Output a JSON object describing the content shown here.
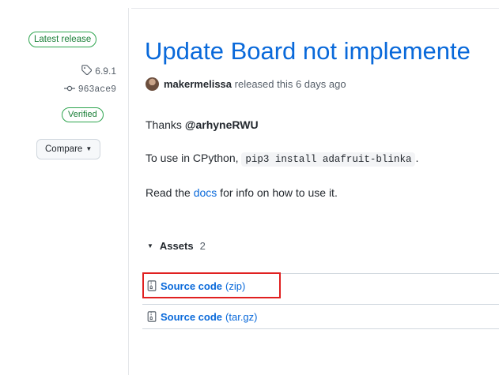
{
  "sidebar": {
    "latest_badge": "Latest release",
    "tag": "6.9.1",
    "commit": "963ace9",
    "verified": "Verified",
    "compare_label": "Compare"
  },
  "release": {
    "title": "Update Board not implemente",
    "author": "makermelissa",
    "released_text": "released this 6 days ago",
    "thanks_prefix": "Thanks ",
    "thanks_user": "@arhyneRWU",
    "cpython_prefix": "To use in CPython,",
    "cpython_command": "pip3 install adafruit-blinka",
    "cpython_suffix": ".",
    "read_prefix": "Read the ",
    "docs_link": "docs",
    "read_suffix": " for info on how to use it."
  },
  "assets": {
    "label": "Assets",
    "count": "2",
    "items": [
      {
        "name": "Source code",
        "format": "(zip)"
      },
      {
        "name": "Source code",
        "format": "(tar.gz)"
      }
    ]
  },
  "colors": {
    "link": "#0969da",
    "green": "#1a7f37",
    "highlight": "#e02020"
  }
}
